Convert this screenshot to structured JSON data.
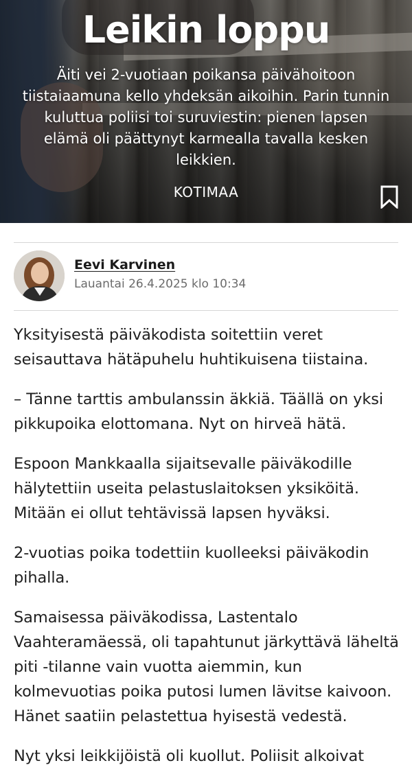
{
  "hero": {
    "title": "Leikin loppu",
    "lead": "Äiti vei 2-vuotiaan poikansa päivähoitoon tiistaiaamuna kello yhdeksän aikoihin. Parin tunnin kuluttua poliisi toi suruviestin: pienen lapsen elämä oli päättynyt karmealla tavalla kesken leikkien.",
    "category": "KOTIMAA",
    "bookmark_icon": "bookmark-icon"
  },
  "author": {
    "name": "Eevi Karvinen",
    "date": "Lauantai 26.4.2025 klo 10:34"
  },
  "article": {
    "paragraphs": [
      "Yksityisestä päiväkodista soitettiin veret seisauttava hätäpuhelu huhtikuisena tiistaina.",
      "– Tänne tarttis ambulanssin äkkiä. Täällä on yksi pikkupoika elottomana. Nyt on hirveä hätä.",
      "Espoon Mankkaalla sijaitsevalle päiväkodille hälytettiin useita pelastuslaitoksen yksiköitä. Mitään ei ollut tehtävissä lapsen hyväksi.",
      "2-vuotias poika todettiin kuolleeksi päiväkodin pihalla.",
      "Samaisessa päiväkodissa, Lastentalo Vaahteramäessä, oli tapahtunut järkyttävä läheltä piti -tilanne vain vuotta aiemmin, kun kolmevuotias poika putosi lumen lävitse kaivoon. Hänet saatiin pelastettua hyisestä vedestä.",
      "Nyt yksi leikkijöistä oli kuollut. Poliisit alkoivat"
    ]
  }
}
